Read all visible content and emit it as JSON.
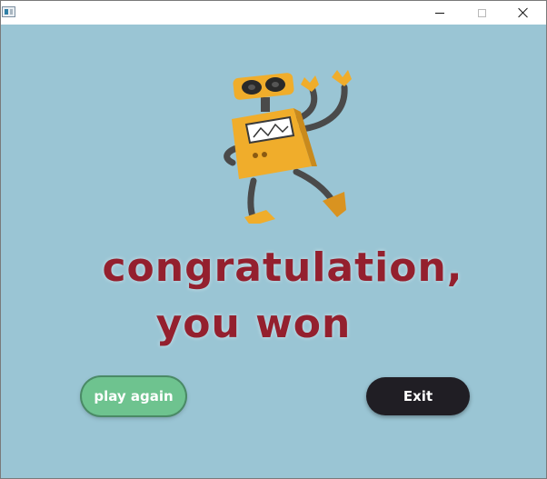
{
  "window": {
    "controls": {
      "minimize_icon": "minimize-icon",
      "maximize_icon": "maximize-icon",
      "close_icon": "close-icon"
    }
  },
  "content": {
    "illustration": "dancing-robot",
    "message_line1": "congratulation,",
    "message_line2": "you won",
    "play_again_label": "play again",
    "exit_label": "Exit"
  },
  "colors": {
    "background": "#9ac5d4",
    "message_text": "#94202e",
    "play_again_button": "#6ec38f",
    "exit_button": "#201e24",
    "robot_body": "#f0ad2b"
  }
}
